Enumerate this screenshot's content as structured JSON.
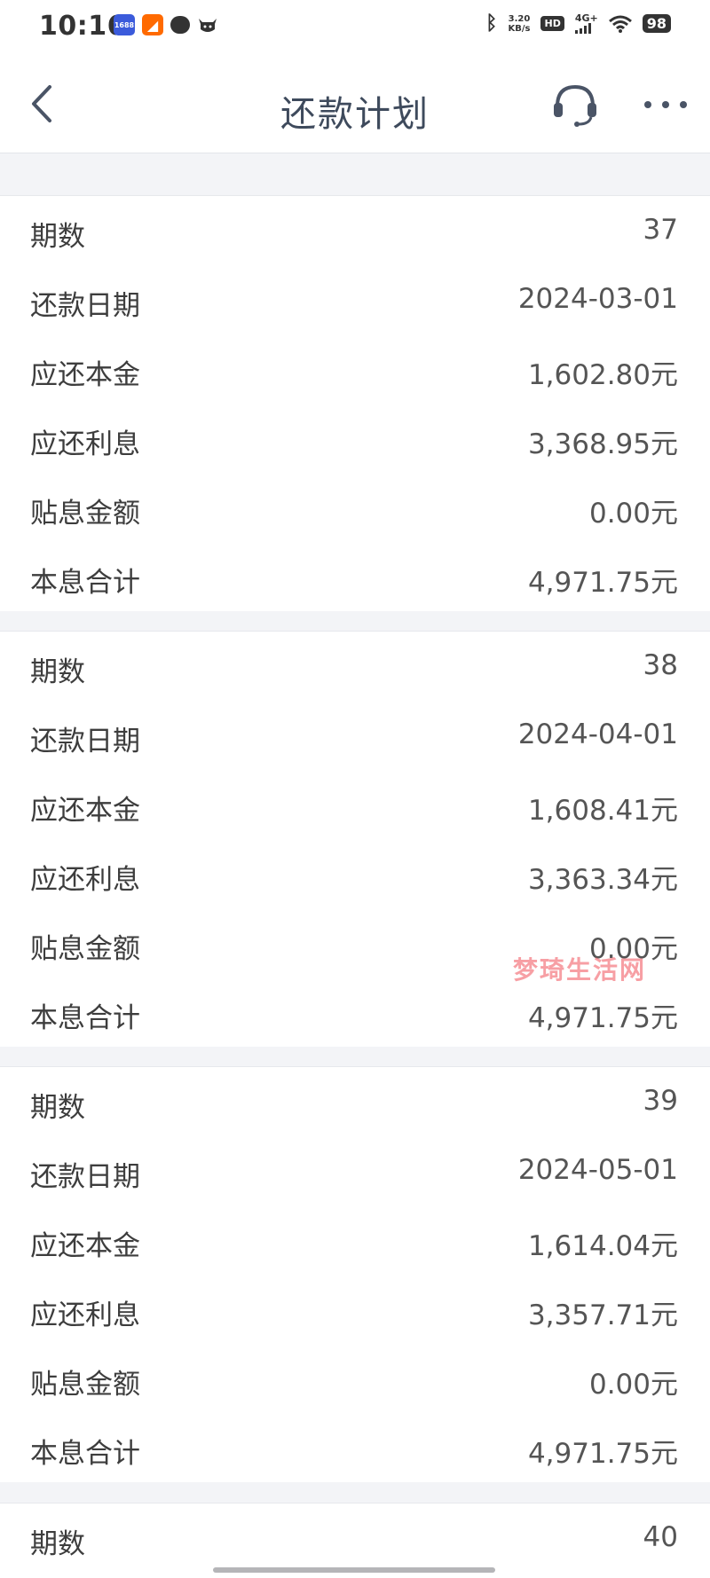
{
  "status_bar": {
    "time": "10:16",
    "icons": [
      "1688-app-icon",
      "taobao-app-icon",
      "message-icon",
      "ox-app-icon"
    ],
    "network_speed_value": "3.20",
    "network_speed_unit": "KB/s",
    "hd_label": "HD",
    "signal_label": "4G+",
    "battery": "98"
  },
  "header": {
    "title": "还款计划",
    "back_icon": "chevron-left-icon",
    "service_icon": "headset-icon",
    "more_icon": "more-dots-icon"
  },
  "labels": {
    "period": "期数",
    "date": "还款日期",
    "principal": "应还本金",
    "interest": "应还利息",
    "subsidy": "贴息金额",
    "total": "本息合计"
  },
  "periods": [
    {
      "period": "37",
      "date": "2024-03-01",
      "principal": "1,602.80元",
      "interest": "3,368.95元",
      "subsidy": "0.00元",
      "total": "4,971.75元"
    },
    {
      "period": "38",
      "date": "2024-04-01",
      "principal": "1,608.41元",
      "interest": "3,363.34元",
      "subsidy": "0.00元",
      "total": "4,971.75元"
    },
    {
      "period": "39",
      "date": "2024-05-01",
      "principal": "1,614.04元",
      "interest": "3,357.71元",
      "subsidy": "0.00元",
      "total": "4,971.75元"
    },
    {
      "period": "40"
    }
  ],
  "watermark": "梦琦生活网",
  "colors": {
    "background": "#f3f4f7",
    "card": "#ffffff",
    "title": "#3e4a5c",
    "watermark": "#f0505a"
  }
}
